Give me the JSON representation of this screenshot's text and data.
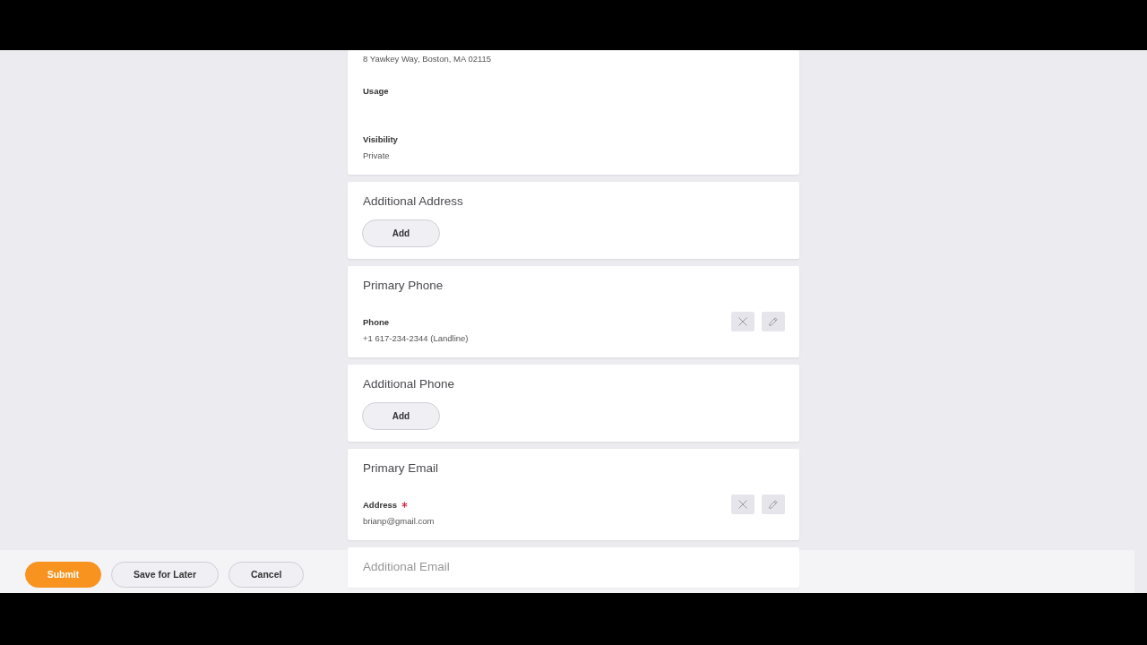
{
  "cards": [
    {
      "kind": "fields",
      "editable": false,
      "fields": [
        {
          "value": "8 Yawkey Way, Boston, MA 02115"
        },
        {
          "label": "Usage",
          "required": false
        },
        {
          "label": "Visibility",
          "value": "Private",
          "required": false
        }
      ]
    },
    {
      "kind": "add",
      "title": "Additional Address",
      "button": "Add"
    },
    {
      "kind": "fields",
      "title": "Primary Phone",
      "editable": true,
      "fields": [
        {
          "label": "Phone",
          "value": "+1 617-234-2344 (Landline)",
          "required": false
        }
      ]
    },
    {
      "kind": "add",
      "title": "Additional Phone",
      "button": "Add"
    },
    {
      "kind": "fields",
      "title": "Primary Email",
      "editable": true,
      "fields": [
        {
          "label": "Address",
          "value": "brianp@gmail.com",
          "required": true
        }
      ]
    },
    {
      "kind": "add",
      "title": "Additional Email"
    }
  ],
  "footer": {
    "buttons": [
      {
        "label": "Submit",
        "kind": "primary"
      },
      {
        "label": "Save for Later",
        "kind": "secondary"
      },
      {
        "label": "Cancel",
        "kind": "secondary"
      }
    ]
  }
}
